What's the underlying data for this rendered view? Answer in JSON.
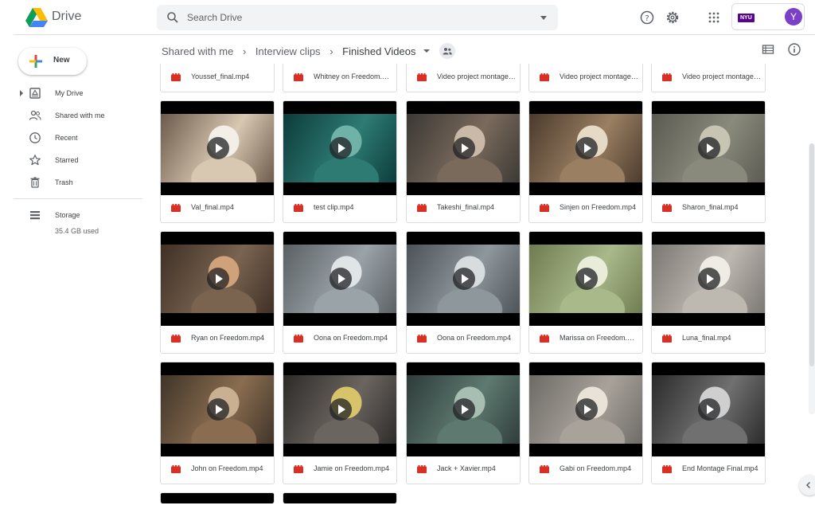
{
  "app": {
    "title": "Drive"
  },
  "search": {
    "placeholder": "Search Drive"
  },
  "header": {
    "org_label": "NYU",
    "avatar_initial": "Y"
  },
  "sidebar": {
    "new_label": "New",
    "items": [
      {
        "label": "My Drive",
        "icon": "my-drive-icon"
      },
      {
        "label": "Shared with me",
        "icon": "people-icon"
      },
      {
        "label": "Recent",
        "icon": "clock-icon"
      },
      {
        "label": "Starred",
        "icon": "star-icon"
      },
      {
        "label": "Trash",
        "icon": "trash-icon"
      }
    ],
    "storage": {
      "label": "Storage",
      "used": "35.4 GB used"
    }
  },
  "breadcrumb": [
    "Shared with me",
    "Interview clips",
    "Finished Videos"
  ],
  "colors": {
    "video_icon": "#d93025",
    "accent": "#1a73e8",
    "avatar": "#7b40c8",
    "org": "#57068c"
  },
  "files": {
    "row0": [
      "Youssef_final.mp4",
      "Whitney on Freedom.mp4",
      "Video project montage.mp4",
      "Video project montage.mp4",
      "Video project montage.mp4"
    ],
    "row1": [
      "Val_final.mp4",
      "test clip.mp4",
      "Takeshi_final.mp4",
      "Sinjen on Freedom.mp4",
      "Sharon_final.mp4"
    ],
    "row2": [
      "Ryan on Freedom.mp4",
      "Oona on Freedom.mp4",
      "Oona on Freedom.mp4",
      "Marissa on Freedom.mp4",
      "Luna_final.mp4"
    ],
    "row3": [
      "John on Freedom.mp4",
      "Jamie on Freedom.mp4",
      "Jack + Xavier.mp4",
      "Gabi on Freedom.mp4",
      "End Montage Final.mp4"
    ]
  }
}
